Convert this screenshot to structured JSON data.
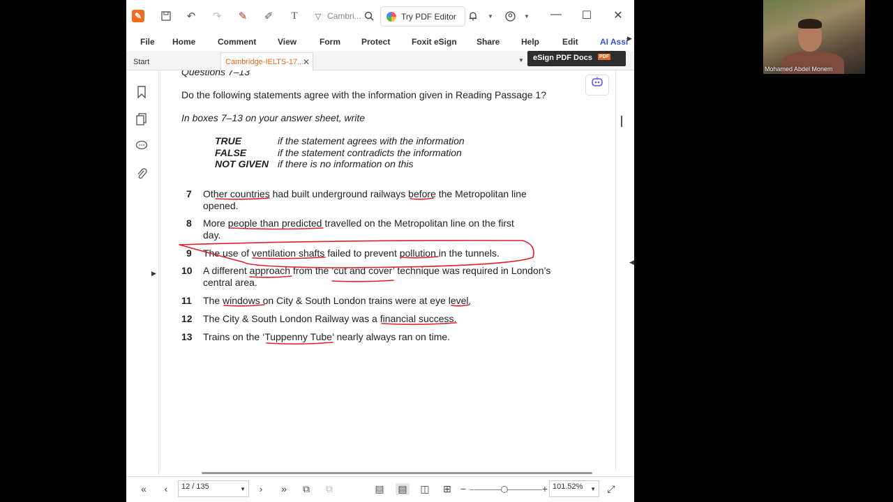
{
  "titlebar": {
    "doc_title_short": "Cambri...",
    "try_editor_label": "Try PDF Editor"
  },
  "menu": {
    "items": [
      "File",
      "Home",
      "Comment",
      "View",
      "Form",
      "Protect",
      "Foxit eSign",
      "Share",
      "Help",
      "Edit",
      "AI Assi"
    ]
  },
  "tabs": {
    "start_label": "Start",
    "doc_label": "Cambridge-IELTS-17...",
    "esign_label": "eSign PDF Docs",
    "esign_mark": "PDF"
  },
  "document": {
    "heading": "Questions 7–13",
    "instruction": "Do the following statements agree with the information given in Reading Passage 1?",
    "subinstruction": "In boxes 7–13 on your answer sheet, write",
    "legend": [
      {
        "key": "TRUE",
        "desc": "if the statement agrees with the information"
      },
      {
        "key": "FALSE",
        "desc": "if the statement contradicts the information"
      },
      {
        "key": "NOT GIVEN",
        "desc": "if there is no information on this"
      }
    ],
    "questions": [
      {
        "num": "7",
        "line1": "Other countries had built underground railways before the Metropolitan line",
        "line2": "opened."
      },
      {
        "num": "8",
        "line1": "More people than predicted travelled on the Metropolitan line on the first",
        "line2": "day."
      },
      {
        "num": "9",
        "line1": "The use of ventilation shafts failed to prevent pollution in the tunnels.",
        "line2": ""
      },
      {
        "num": "10",
        "line1": "A different approach from the ‘cut and cover’ technique was required in London’s",
        "line2": "central area."
      },
      {
        "num": "11",
        "line1": "The windows on City & South London trains were at eye level.",
        "line2": ""
      },
      {
        "num": "12",
        "line1": "The City & South London Railway was a financial success.",
        "line2": ""
      },
      {
        "num": "13",
        "line1": "Trains on the ‘Tuppenny Tube’ nearly always ran on time.",
        "line2": ""
      }
    ]
  },
  "status": {
    "page": "12 / 135",
    "zoom": "101.52%"
  },
  "webcam": {
    "name": "Mohamed Abdel Monem"
  },
  "colors": {
    "accent": "#e86a1c",
    "annotation": "#e0202a",
    "ai_link": "#2f56d6"
  }
}
